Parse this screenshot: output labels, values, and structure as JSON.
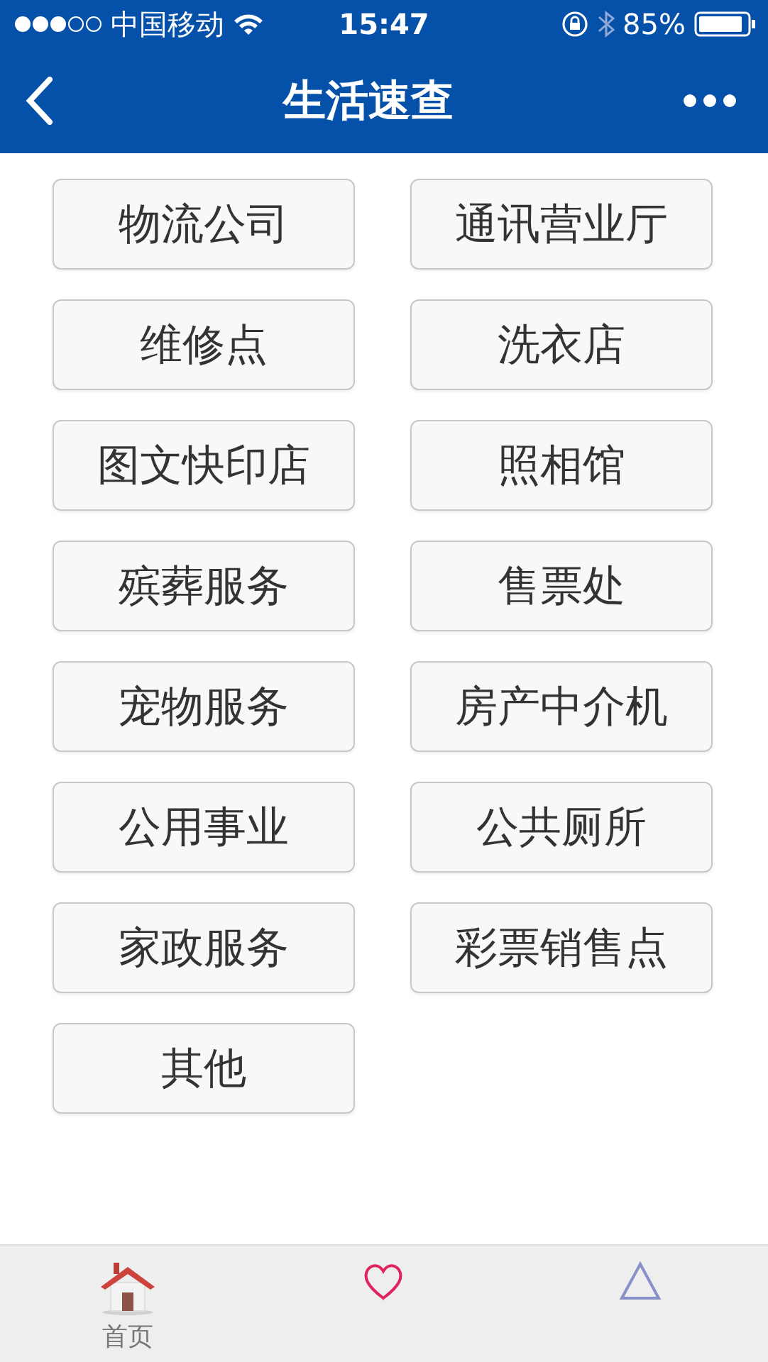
{
  "status_bar": {
    "carrier": "中国移动",
    "time": "15:47",
    "battery": "85%"
  },
  "nav": {
    "title": "生活速查"
  },
  "categories": [
    "物流公司",
    "通讯营业厅",
    "维修点",
    "洗衣店",
    "图文快印店",
    "照相馆",
    "殡葬服务",
    "售票处",
    "宠物服务",
    "房产中介机",
    "公用事业",
    "公共厕所",
    "家政服务",
    "彩票销售点",
    "其他"
  ],
  "tab_bar": [
    {
      "kind": "home",
      "label": "首页",
      "selected": false
    },
    {
      "kind": "heart",
      "selected": true
    },
    {
      "kind": "triangle",
      "selected": false
    }
  ]
}
